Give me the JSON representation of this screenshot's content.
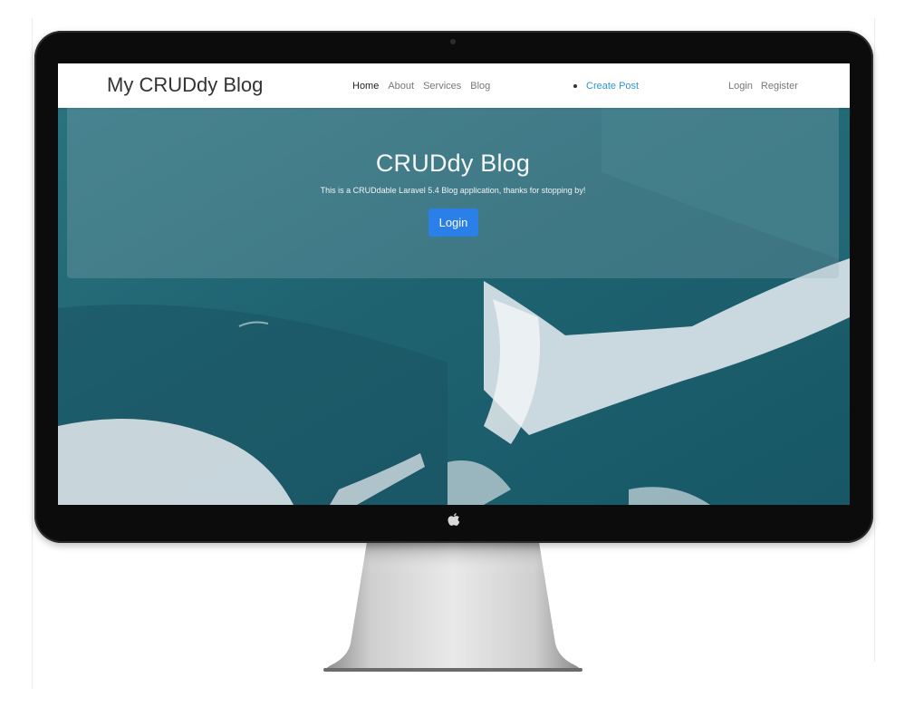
{
  "navbar": {
    "brand": "My CRUDdy Blog",
    "links": [
      {
        "label": "Home",
        "active": true
      },
      {
        "label": "About",
        "active": false
      },
      {
        "label": "Services",
        "active": false
      },
      {
        "label": "Blog",
        "active": false
      }
    ],
    "create_post": "Create Post",
    "auth": {
      "login": "Login",
      "register": "Register"
    }
  },
  "jumbotron": {
    "title": "CRUDdy Blog",
    "subtitle": "This is a CRUDdable Laravel 5.4 Blog application, thanks for stopping by!",
    "button_label": "Login"
  },
  "colors": {
    "accent": "#3097d1",
    "button": "#2a7fe8",
    "sea": "#1e5d6c"
  },
  "icons": {
    "monitor_logo": "apple-logo-icon"
  }
}
